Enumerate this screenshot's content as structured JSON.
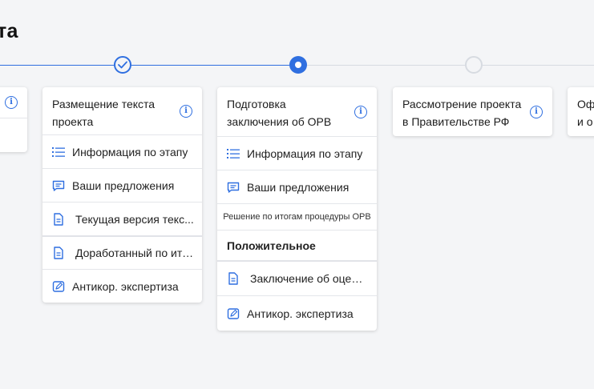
{
  "page": {
    "title": "та"
  },
  "stages": [
    {
      "status": "done",
      "title": "Размещение текста проекта",
      "items": [
        {
          "icon": "list-icon",
          "label": "Информация по этапу"
        },
        {
          "icon": "comment-icon",
          "label": "Ваши предложения"
        },
        {
          "icon": "document-icon",
          "label": "Текущая версия текс..."
        },
        {
          "icon": "document-icon",
          "label": "Доработанный по ито..."
        },
        {
          "icon": "edit-icon",
          "label": "Антикор. экспертиза"
        }
      ]
    },
    {
      "status": "current",
      "title": "Подготовка заключения об ОРВ",
      "items": [
        {
          "icon": "list-icon",
          "label": "Информация по этапу"
        },
        {
          "icon": "comment-icon",
          "label": "Ваши предложения"
        }
      ],
      "decision_label": "Решение по итогам процедуры ОРВ",
      "decision_value": "Положительное",
      "after_items": [
        {
          "icon": "document-icon",
          "label": "Заключение об оценк..."
        },
        {
          "icon": "edit-icon",
          "label": "Антикор. экспертиза"
        }
      ]
    },
    {
      "status": "pending",
      "title": "Рассмотрение проекта в Правительстве РФ"
    },
    {
      "status": "pending",
      "title": "Офи опу"
    }
  ],
  "prev_stage": {
    "status": "done"
  },
  "info_glyph": "i",
  "colors": {
    "accent": "#2f6fe0",
    "line_pending": "#d7dbe1",
    "background": "#f4f5f7"
  }
}
